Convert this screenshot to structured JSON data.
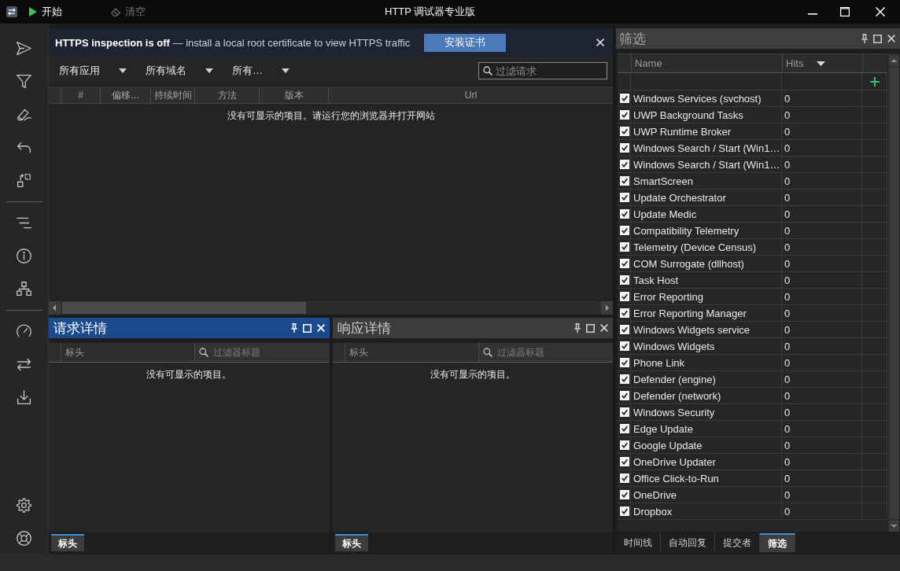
{
  "title_bar": {
    "buttons": [
      {
        "kind": "start",
        "label": "开始",
        "disabled": false
      },
      {
        "kind": "clear",
        "label": "清空",
        "disabled": true
      }
    ],
    "title": "HTTP 调试器专业版"
  },
  "banner": {
    "message": "**HTTPS inspection is off** — install a local root certificate to view HTTPS traffic",
    "button": "安装证书"
  },
  "toolbar": {
    "dropdowns": [
      "所有应用",
      "所有域名",
      "所有…"
    ],
    "search": {
      "placeholder": "过滤请求"
    }
  },
  "sessions_table": {
    "columns": [
      "#",
      "偏移...",
      "持续时间",
      "方法",
      "版本",
      "Url"
    ],
    "empty_message": "没有可显示的项目。请运行您的浏览器并打开网站"
  },
  "detail_panels": [
    {
      "title": "请求详情",
      "active": true,
      "columns": [
        "标头"
      ],
      "filter": {
        "placeholder": "过滤器标题"
      },
      "empty_message": "没有可显示的项目。",
      "tabs": [
        {
          "label": "标头",
          "selected": true
        }
      ]
    },
    {
      "title": "响应详情",
      "active": false,
      "columns": [
        "标头"
      ],
      "filter": {
        "placeholder": "过滤器标题"
      },
      "empty_message": "没有可显示的项目。",
      "tabs": [
        {
          "label": "标头",
          "selected": true
        }
      ]
    }
  ],
  "filter_panel": {
    "title": "筛选",
    "columns": [
      "Name",
      "Hits"
    ],
    "rows": [
      {
        "name": "Windows Services (svchost)",
        "hits": "0",
        "checked": true
      },
      {
        "name": "UWP Background Tasks",
        "hits": "0",
        "checked": true
      },
      {
        "name": "UWP Runtime Broker",
        "hits": "0",
        "checked": true
      },
      {
        "name": "Windows Search / Start (Win1…",
        "hits": "0",
        "checked": true
      },
      {
        "name": "Windows Search / Start (Win1…",
        "hits": "0",
        "checked": true
      },
      {
        "name": "SmartScreen",
        "hits": "0",
        "checked": true
      },
      {
        "name": "Update Orchestrator",
        "hits": "0",
        "checked": true
      },
      {
        "name": "Update Medic",
        "hits": "0",
        "checked": true
      },
      {
        "name": "Compatibility Telemetry",
        "hits": "0",
        "checked": true
      },
      {
        "name": "Telemetry (Device Census)",
        "hits": "0",
        "checked": true
      },
      {
        "name": "COM Surrogate (dllhost)",
        "hits": "0",
        "checked": true
      },
      {
        "name": "Task Host",
        "hits": "0",
        "checked": true
      },
      {
        "name": "Error Reporting",
        "hits": "0",
        "checked": true
      },
      {
        "name": "Error Reporting Manager",
        "hits": "0",
        "checked": true
      },
      {
        "name": "Windows Widgets service",
        "hits": "0",
        "checked": true
      },
      {
        "name": "Windows Widgets",
        "hits": "0",
        "checked": true
      },
      {
        "name": "Phone Link",
        "hits": "0",
        "checked": true
      },
      {
        "name": "Defender (engine)",
        "hits": "0",
        "checked": true
      },
      {
        "name": "Defender (network)",
        "hits": "0",
        "checked": true
      },
      {
        "name": "Windows Security",
        "hits": "0",
        "checked": true
      },
      {
        "name": "Edge Update",
        "hits": "0",
        "checked": true
      },
      {
        "name": "Google Update",
        "hits": "0",
        "checked": true
      },
      {
        "name": "OneDrive Updater",
        "hits": "0",
        "checked": true
      },
      {
        "name": "Office Click-to-Run",
        "hits": "0",
        "checked": true
      },
      {
        "name": "OneDrive",
        "hits": "0",
        "checked": true
      },
      {
        "name": "Dropbox",
        "hits": "0",
        "checked": true
      }
    ],
    "tabs": [
      {
        "label": "时间线",
        "selected": false
      },
      {
        "label": "自动回复",
        "selected": false
      },
      {
        "label": "提交者",
        "selected": false
      },
      {
        "label": "筛选",
        "selected": true
      }
    ]
  }
}
